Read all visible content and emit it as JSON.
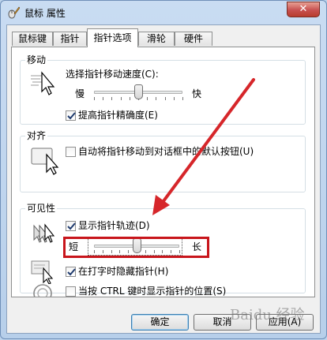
{
  "window": {
    "title": "鼠标 属性",
    "close_glyph": "✕"
  },
  "tabs": [
    {
      "label": "鼠标键",
      "active": false
    },
    {
      "label": "指针",
      "active": false
    },
    {
      "label": "指针选项",
      "active": true
    },
    {
      "label": "滑轮",
      "active": false
    },
    {
      "label": "硬件",
      "active": false
    }
  ],
  "motion": {
    "legend": "移动",
    "speed_label": "选择指针移动速度(C):",
    "slow": "慢",
    "fast": "快",
    "speed_level": 0.5,
    "precision_label": "提高指针精确度(E)",
    "precision_checked": true
  },
  "snap": {
    "legend": "对齐",
    "label": "自动将指针移动到对话框中的默认按钮(U)",
    "checked": false
  },
  "visibility": {
    "legend": "可见性",
    "trails_label": "显示指针轨迹(D)",
    "trails_checked": true,
    "short": "短",
    "long": "长",
    "trail_level": 0.5,
    "hide_label": "在打字时隐藏指针(H)",
    "hide_checked": true,
    "ctrl_label": "当按 CTRL 键时显示指针的位置(S)",
    "ctrl_checked": false
  },
  "buttons": {
    "ok": "确定",
    "cancel": "取消",
    "apply": "应用(A)"
  },
  "icons": {
    "app": "mouse-pencil-icon",
    "speed": "pointer-speed-icon",
    "snap": "snap-to-button-icon",
    "trails": "pointer-trails-icon",
    "hide": "hide-while-typing-icon",
    "ctrl": "show-location-icon"
  },
  "colors": {
    "highlight": "#c8151b",
    "title_bg": "#c9dcf2",
    "close": "#c75050"
  },
  "watermark": "Baidu 经验"
}
